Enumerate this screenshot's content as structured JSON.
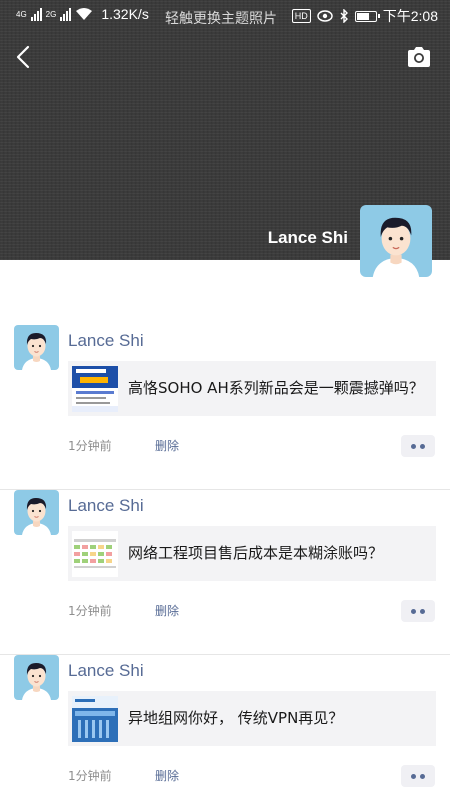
{
  "status_bar": {
    "net1": "4G",
    "net2": "2G",
    "speed": "1.32K/s",
    "ticker": "轻触更换主题照片",
    "hd": "HD",
    "time": "下午2:08"
  },
  "header": {
    "name": "Lance Shi"
  },
  "posts": [
    {
      "author": "Lance Shi",
      "title": "高恪SOHO AH系列新品会是一颗震撼弹吗？",
      "time": "1分钟前",
      "delete_label": "删除"
    },
    {
      "author": "Lance Shi",
      "title": "网络工程项目售后成本是本糊涂账吗？",
      "time": "1分钟前",
      "delete_label": "删除"
    },
    {
      "author": "Lance Shi",
      "title": "异地组网你好， 传统VPN再见？",
      "time": "1分钟前",
      "delete_label": "删除"
    }
  ],
  "colors": {
    "link": "#576b95",
    "cover": "#3b3b3b",
    "share_bg": "#f3f3f5"
  }
}
